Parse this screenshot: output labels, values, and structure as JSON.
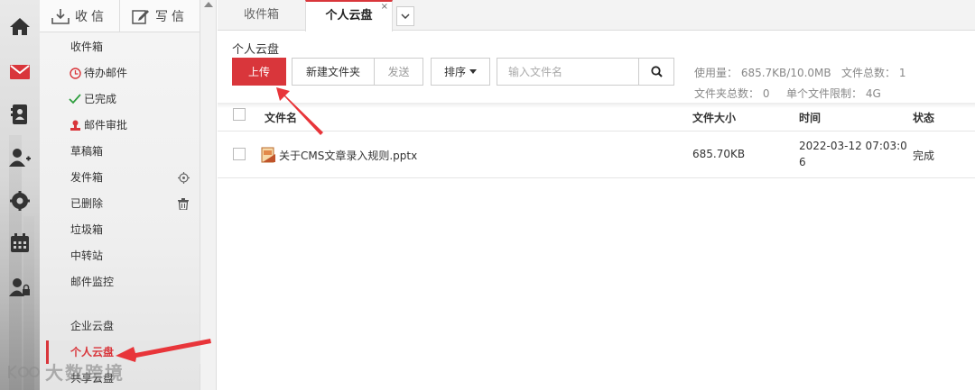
{
  "sidebar": {
    "receive_label": "收信",
    "compose_label": "写信",
    "folders": [
      {
        "label": "收件箱"
      },
      {
        "label": "待办邮件"
      },
      {
        "label": "已完成"
      },
      {
        "label": "邮件审批"
      },
      {
        "label": "草稿箱"
      },
      {
        "label": "发件箱"
      },
      {
        "label": "已删除"
      },
      {
        "label": "垃圾箱"
      },
      {
        "label": "中转站"
      },
      {
        "label": "邮件监控"
      }
    ],
    "groups": [
      {
        "label": "企业云盘"
      },
      {
        "label": "个人云盘"
      },
      {
        "label": "共享云盘"
      }
    ],
    "active": "个人云盘"
  },
  "tabs": [
    {
      "label": "收件箱"
    },
    {
      "label": "个人云盘",
      "close": "×"
    }
  ],
  "main": {
    "title": "个人云盘",
    "toolbar": {
      "upload": "上传",
      "new_folder": "新建文件夹",
      "send": "发送",
      "sort": "排序"
    },
    "search_placeholder": "输入文件名",
    "stats": {
      "usage": "使用量： 685.7KB/10.0MB",
      "file_total": "文件总数： 1",
      "folder_total": "文件夹总数： 0",
      "single_limit": "单个文件限制： 4G"
    },
    "table": {
      "headers": {
        "name": "文件名",
        "size": "文件大小",
        "time": "时间",
        "status": "状态"
      },
      "rows": [
        {
          "name": "关于CMS文章录入规则.pptx",
          "size": "685.70KB",
          "time_line1": "2022-03-12 07:03:0",
          "time_line2": "6",
          "status": "完成"
        }
      ]
    }
  },
  "watermark": "大数跨境",
  "colors": {
    "accent": "#d9363b",
    "annotation_arrow": "#e8353a"
  }
}
